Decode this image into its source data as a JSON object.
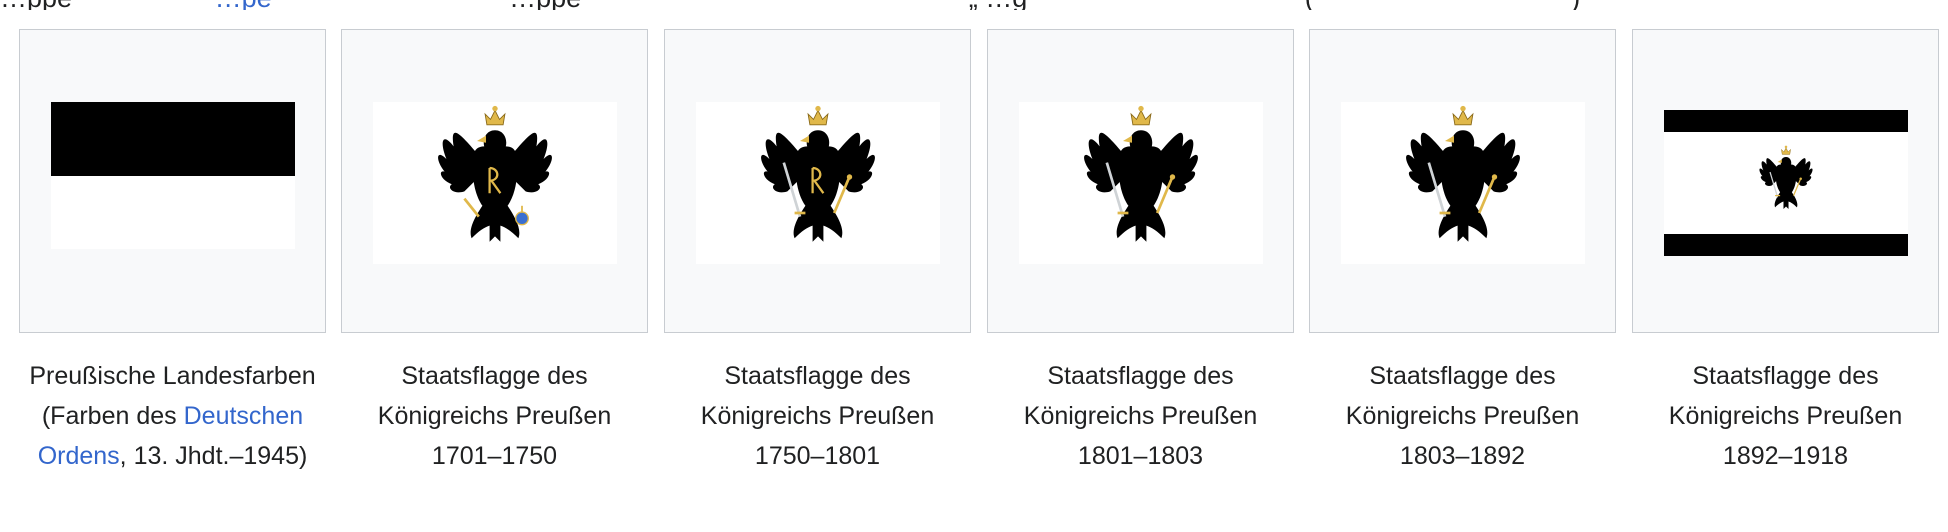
{
  "intro": {
    "text_a": "…ppe",
    "link_a": "…pe",
    "text_b": "…ppe",
    "text_c": "„ …g",
    "text_d": "(",
    "text_e": ")"
  },
  "gallery": {
    "items": [
      {
        "flag_icon": "prussian-black-white-bicolor-icon",
        "caption": {
          "pre": "Preußische Landesfarben (Farben des ",
          "link": "Deutschen Ordens",
          "post": ", 13. Jhdt.–1945)"
        }
      },
      {
        "flag_icon": "prussian-eagle-flag-icon",
        "caption": {
          "text": "Staatsflagge des Königreichs Preußen 1701–1750"
        }
      },
      {
        "flag_icon": "prussian-eagle-flag-icon",
        "caption": {
          "text": "Staatsflagge des Königreichs Preußen 1750–1801"
        }
      },
      {
        "flag_icon": "prussian-eagle-flag-icon",
        "caption": {
          "text": "Staatsflagge des Königreichs Preußen 1801–1803"
        }
      },
      {
        "flag_icon": "prussian-eagle-flag-icon",
        "caption": {
          "text": "Staatsflagge des Königreichs Preußen 1803–1892"
        }
      },
      {
        "flag_icon": "prussian-state-flag-stripes-icon",
        "caption": {
          "text": "Staatsflagge des Königreichs Preußen 1892–1918"
        }
      }
    ]
  },
  "colors": {
    "link": "#3366cc",
    "text": "#202122",
    "thumb_bg": "#f8f9fa",
    "thumb_border": "#c8ccd1",
    "eagle": "#000000",
    "gold": "#e0b84a"
  }
}
